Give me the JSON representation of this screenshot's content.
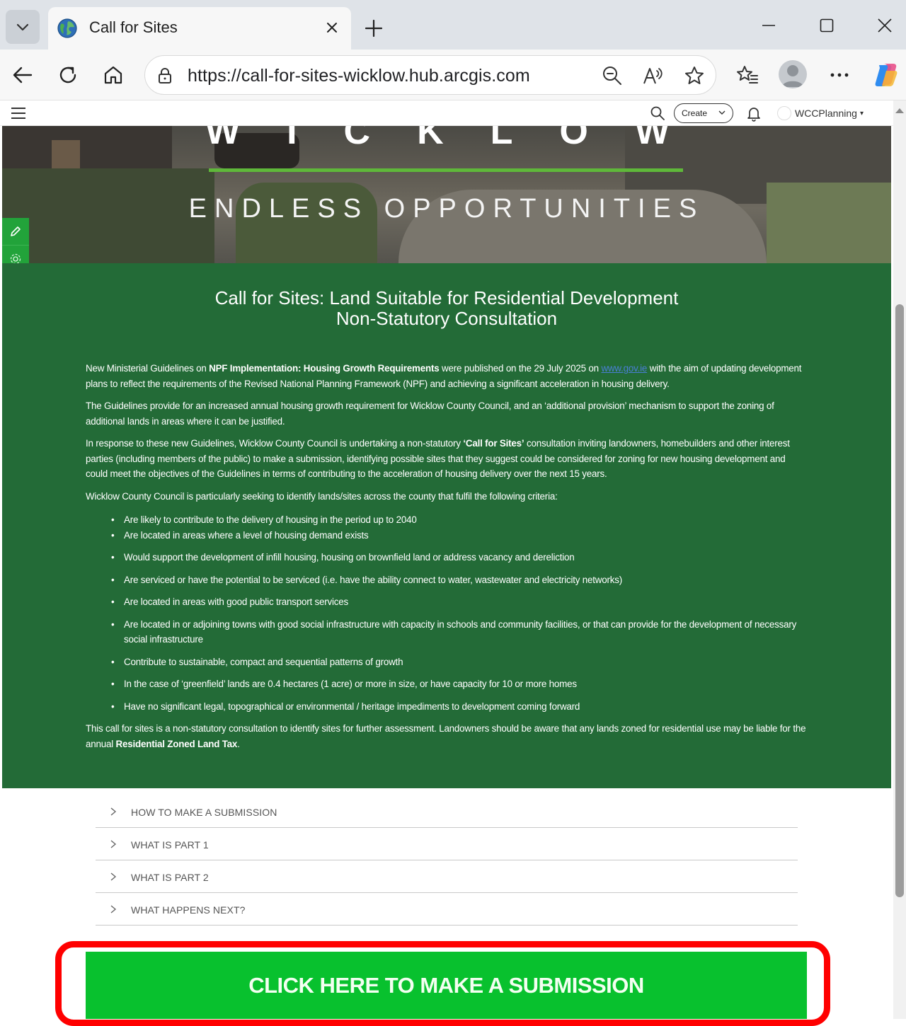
{
  "browser": {
    "tab_title": "Call for Sites",
    "url": "https://call-for-sites-wicklow.hub.arcgis.com"
  },
  "site_header": {
    "create_label": "Create",
    "username": "WCCPlanning"
  },
  "hero": {
    "wordmark": "WICKLOW",
    "tagline": "ENDLESS OPPORTUNITIES"
  },
  "content": {
    "title_line1": "Call for Sites: Land Suitable for Residential Development",
    "title_line2": "Non-Statutory Consultation",
    "p1_a": "New Ministerial Guidelines on ",
    "p1_b": "NPF Implementation: Housing Growth Requirements",
    "p1_c": " were published on the 29 July 2025 on ",
    "p1_link": "www.gov.ie",
    "p1_d": " with the aim of updating development plans to reflect the requirements of the Revised National Planning Framework (NPF) and achieving a significant acceleration in housing delivery.",
    "p2": "The Guidelines provide for an increased annual housing growth requirement for Wicklow County Council, and an ‘additional provision’ mechanism to support the zoning of additional lands in areas where it can be justified.",
    "p3_a": "In response to these new Guidelines, Wicklow County Council is undertaking a non-statutory ",
    "p3_b": "‘Call for Sites’",
    "p3_c": " consultation inviting landowners, homebuilders and other interest parties (including members of the public) to make a submission, identifying possible sites that they suggest could be considered for zoning for new housing development and could meet the objectives of the Guidelines in terms of contributing to the acceleration of housing delivery over the next 15 years.",
    "p4": "Wicklow County Council is particularly seeking to identify lands/sites across the county that fulfil the following criteria:",
    "criteria": [
      "Are likely to contribute to the delivery of housing in the period up to 2040",
      "Are located in areas where a level of housing demand exists",
      "Would support the development of infill housing, housing on brownfield land or address vacancy and dereliction",
      "Are serviced or have the potential to be serviced (i.e. have the ability connect to water, wastewater and electricity networks)",
      "Are located in areas with good public transport services",
      "Are located in or adjoining towns with good social infrastructure with capacity in schools and community facilities, or that can provide for the development of necessary social infrastructure",
      "Contribute to sustainable, compact and sequential patterns of growth",
      "In the case of ‘greenfield’ lands are 0.4 hectares (1 acre) or more in size, or have capacity for 10 or more homes",
      "Have no significant legal, topographical or environmental / heritage impediments to development coming forward"
    ],
    "p5_a": "This call for sites is a non-statutory consultation to identify sites for further assessment. Landowners should be aware that any lands zoned for residential use may be liable for the annual ",
    "p5_b": "Residential Zoned Land Tax",
    "p5_c": "."
  },
  "accordion": [
    "HOW TO MAKE A SUBMISSION",
    "WHAT IS PART 1",
    "WHAT IS PART 2",
    "WHAT HAPPENS NEXT?"
  ],
  "cta_label": "CLICK HERE TO MAKE A SUBMISSION",
  "colors": {
    "content_green": "#236b37",
    "cta_green": "#08c12e",
    "highlight_red": "#ff0000",
    "accent_line": "#5fb83a"
  }
}
